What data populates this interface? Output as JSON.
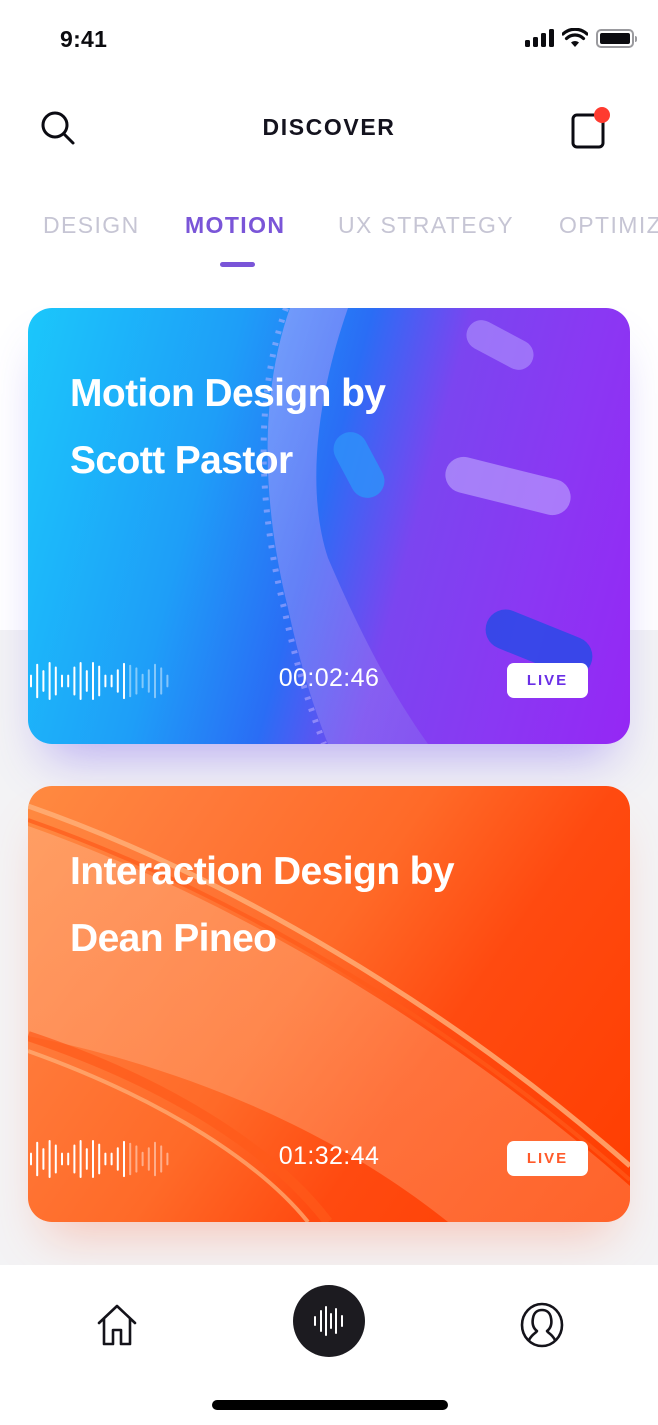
{
  "status_bar": {
    "time": "9:41"
  },
  "header": {
    "title": "DISCOVER",
    "search_icon": "search-icon",
    "notification_icon": "notification-square-icon",
    "has_notification": true
  },
  "tabs": [
    {
      "label": "DESIGN",
      "active": false
    },
    {
      "label": "MOTION",
      "active": true
    },
    {
      "label": "UX STRATEGY",
      "active": false
    },
    {
      "label": "OPTIMIZ",
      "active": false
    }
  ],
  "cards": [
    {
      "title": "Motion Design by Scott Pastor",
      "title_line1": "Motion Design by",
      "title_line2": "Scott Pastor",
      "timer": "00:02:46",
      "badge": "LIVE",
      "theme": "blue-purple",
      "accent": "#6a2fe6"
    },
    {
      "title": "Interaction Design by Dean Pineo",
      "title_line1": "Interaction Design by",
      "title_line2": "Dean Pineo",
      "timer": "01:32:44",
      "badge": "LIVE",
      "theme": "orange",
      "accent": "#ff5a2a"
    }
  ],
  "bottom_nav": {
    "items": [
      {
        "name": "home",
        "icon": "home-icon"
      },
      {
        "name": "live-audio",
        "icon": "waveform-icon",
        "active": true
      },
      {
        "name": "profile",
        "icon": "profile-icon"
      }
    ]
  },
  "colors": {
    "accent": "#7a55d8",
    "tab_inactive": "#c6c5d4",
    "notification_dot": "#ff3b30",
    "nav_center_bg": "#1c1b20"
  }
}
